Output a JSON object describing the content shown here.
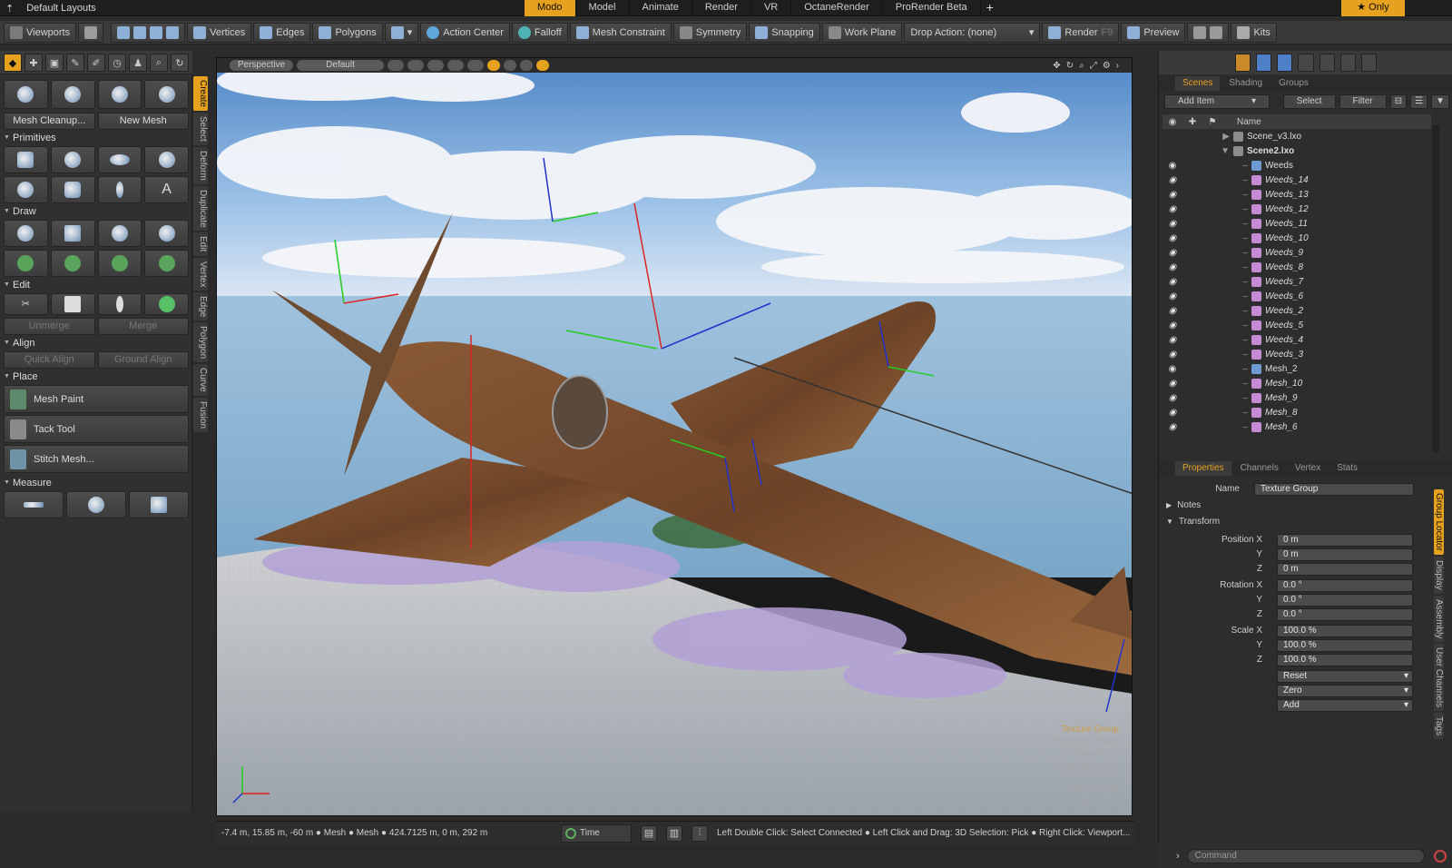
{
  "menubar": {
    "layout_label": "Default Layouts",
    "tabs": [
      {
        "label": "Modo",
        "active": true
      },
      {
        "label": "Model"
      },
      {
        "label": "Animate"
      },
      {
        "label": "Render"
      },
      {
        "label": "VR"
      },
      {
        "label": "OctaneRender"
      },
      {
        "label": "ProRender Beta"
      }
    ],
    "add_tab": "+",
    "only_label": "★  Only"
  },
  "toolbar": {
    "viewports": "Viewports",
    "vertices": "Vertices",
    "edges": "Edges",
    "polygons": "Polygons",
    "action_center": "Action Center",
    "falloff": "Falloff",
    "mesh_constraint": "Mesh Constraint",
    "symmetry": "Symmetry",
    "snapping": "Snapping",
    "work_plane": "Work Plane",
    "drop_action": "Drop Action: (none)",
    "render": "Render",
    "render_key": "F9",
    "preview": "Preview",
    "kits": "Kits"
  },
  "left": {
    "mesh_cleanup": "Mesh Cleanup...",
    "new_mesh": "New Mesh",
    "primitives": "Primitives",
    "draw": "Draw",
    "edit": "Edit",
    "unmerge": "Unmerge",
    "merge": "Merge",
    "align": "Align",
    "quick_align": "Quick Align",
    "ground_align": "Ground Align",
    "place": "Place",
    "mesh_paint": "Mesh Paint",
    "tack_tool": "Tack Tool",
    "stitch_mesh": "Stitch Mesh...",
    "measure": "Measure",
    "vtabs": [
      "Create",
      "Select",
      "Deform",
      "Duplicate",
      "Edit",
      "Vertex",
      "Edge",
      "Polygon",
      "Curve",
      "Fusion"
    ]
  },
  "viewport": {
    "view_name": "Perspective",
    "shading": "Default",
    "info": {
      "title": "Texture Group",
      "polygons": "Polygons : Face",
      "channels": "Channels : 0",
      "deformers": "Deformers : ON",
      "gl": "GL : 0,473,911",
      "shading": "Ray-Tracing",
      "units": "Units : 1 m"
    }
  },
  "statusbar": {
    "coords": "-7.4 m, 15.85 m, -60 m ● Mesh ● Mesh ● 424.7125 m, 0 m, 292 m",
    "time": "Time",
    "hint": "Left Double Click: Select Connected ● Left Click and Drag: 3D Selection: Pick ● Right Click: Viewport..."
  },
  "scene_panel": {
    "tabs": [
      "Scenes",
      "Shading",
      "Groups"
    ],
    "add_item": "Add Item",
    "select": "Select",
    "filter": "Filter",
    "name_col": "Name",
    "items": [
      {
        "name": "Scene_v3.lxo",
        "indent": 0,
        "type": "scene",
        "italic": false
      },
      {
        "name": "Scene2.lxo",
        "indent": 0,
        "type": "scene",
        "italic": false,
        "bold": true
      },
      {
        "name": "Weeds",
        "indent": 2,
        "type": "group",
        "italic": false
      },
      {
        "name": "Weeds_14",
        "indent": 2,
        "type": "mesh",
        "italic": true
      },
      {
        "name": "Weeds_13",
        "indent": 2,
        "type": "mesh",
        "italic": true
      },
      {
        "name": "Weeds_12",
        "indent": 2,
        "type": "mesh",
        "italic": true
      },
      {
        "name": "Weeds_11",
        "indent": 2,
        "type": "mesh",
        "italic": true
      },
      {
        "name": "Weeds_10",
        "indent": 2,
        "type": "mesh",
        "italic": true
      },
      {
        "name": "Weeds_9",
        "indent": 2,
        "type": "mesh",
        "italic": true
      },
      {
        "name": "Weeds_8",
        "indent": 2,
        "type": "mesh",
        "italic": true
      },
      {
        "name": "Weeds_7",
        "indent": 2,
        "type": "mesh",
        "italic": true
      },
      {
        "name": "Weeds_6",
        "indent": 2,
        "type": "mesh",
        "italic": true
      },
      {
        "name": "Weeds_2",
        "indent": 2,
        "type": "mesh",
        "italic": true
      },
      {
        "name": "Weeds_5",
        "indent": 2,
        "type": "mesh",
        "italic": true
      },
      {
        "name": "Weeds_4",
        "indent": 2,
        "type": "mesh",
        "italic": true
      },
      {
        "name": "Weeds_3",
        "indent": 2,
        "type": "mesh",
        "italic": true
      },
      {
        "name": "Mesh_2",
        "indent": 2,
        "type": "group",
        "italic": false
      },
      {
        "name": "Mesh_10",
        "indent": 2,
        "type": "mesh",
        "italic": true
      },
      {
        "name": "Mesh_9",
        "indent": 2,
        "type": "mesh",
        "italic": true
      },
      {
        "name": "Mesh_8",
        "indent": 2,
        "type": "mesh",
        "italic": true
      },
      {
        "name": "Mesh_6",
        "indent": 2,
        "type": "mesh",
        "italic": true
      }
    ]
  },
  "properties": {
    "tabs": [
      "Properties",
      "Channels",
      "Vertex",
      "Stats"
    ],
    "name_label": "Name",
    "name_value": "Texture Group",
    "notes": "Notes",
    "transform": "Transform",
    "position_label": "Position X",
    "rotation_label": "Rotation X",
    "scale_label": "Scale X",
    "y": "Y",
    "z": "Z",
    "pos": [
      "0 m",
      "0 m",
      "0 m"
    ],
    "rot": [
      "0.0 °",
      "0.0 °",
      "0.0 °"
    ],
    "scale": [
      "100.0 %",
      "100.0 %",
      "100.0 %"
    ],
    "reset": "Reset",
    "zero": "Zero",
    "add": "Add",
    "side_tabs": [
      "Group Locator",
      "Display",
      "Assembly",
      "User Channels",
      "Tags"
    ]
  },
  "command": {
    "placeholder": "Command"
  }
}
